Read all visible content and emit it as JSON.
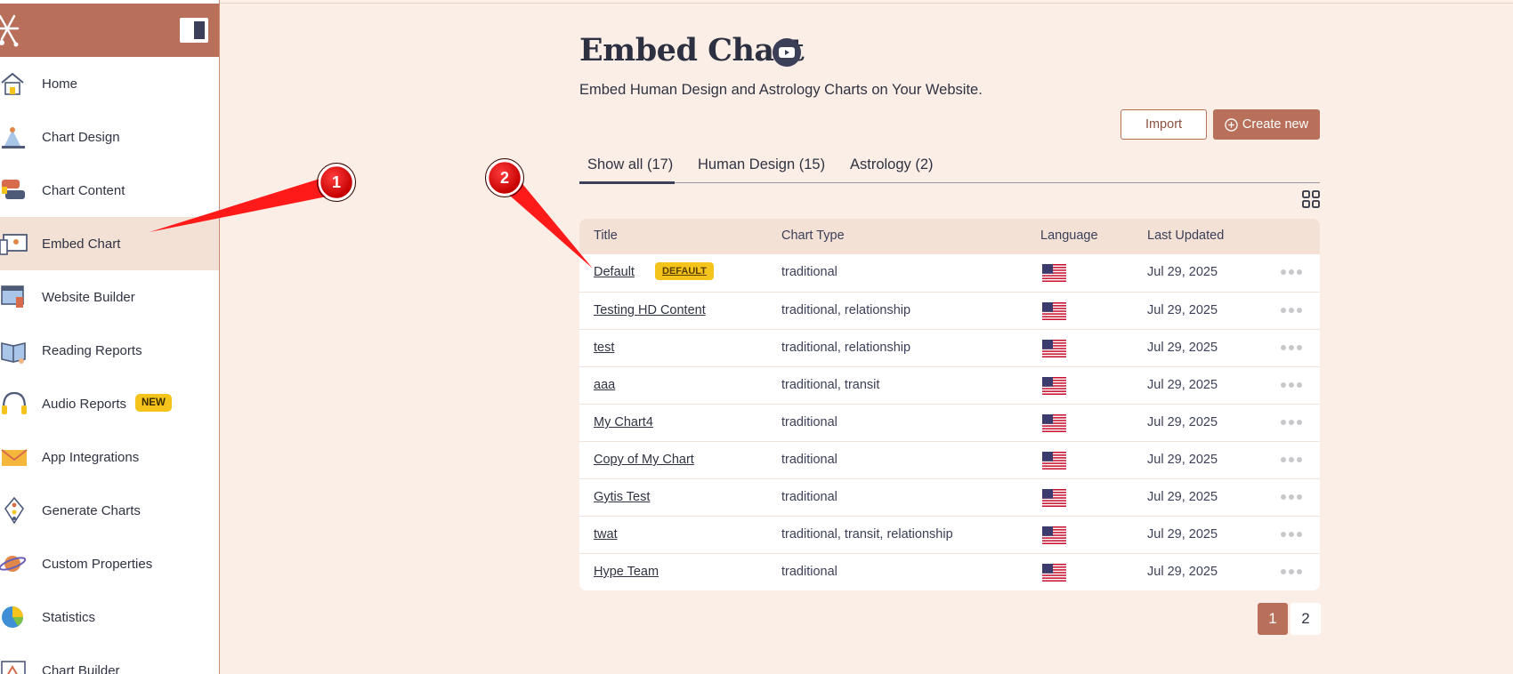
{
  "sidebar": {
    "items": [
      {
        "label": "Home",
        "icon": "home-icon"
      },
      {
        "label": "Chart Design",
        "icon": "chart-design-icon"
      },
      {
        "label": "Chart Content",
        "icon": "chart-content-icon"
      },
      {
        "label": "Embed Chart",
        "icon": "embed-chart-icon",
        "active": true
      },
      {
        "label": "Website Builder",
        "icon": "website-builder-icon"
      },
      {
        "label": "Reading Reports",
        "icon": "reading-reports-icon"
      },
      {
        "label": "Audio Reports",
        "icon": "headphones-icon",
        "badge": "NEW"
      },
      {
        "label": "App Integrations",
        "icon": "envelope-icon"
      },
      {
        "label": "Generate Charts",
        "icon": "generate-charts-icon"
      },
      {
        "label": "Custom Properties",
        "icon": "planet-icon"
      },
      {
        "label": "Statistics",
        "icon": "pie-chart-icon"
      },
      {
        "label": "Chart Builder",
        "icon": "chart-builder-icon"
      }
    ]
  },
  "header": {
    "title": "Embed Chart",
    "subtitle": "Embed Human Design and Astrology Charts on Your Website."
  },
  "actions": {
    "import_label": "Import",
    "create_label": "Create new"
  },
  "tabs": [
    {
      "label": "Show all (17)",
      "active": true
    },
    {
      "label": "Human Design (15)"
    },
    {
      "label": "Astrology (2)"
    }
  ],
  "table": {
    "columns": [
      "Title",
      "Chart Type",
      "Language",
      "Last Updated"
    ],
    "default_badge": "DEFAULT",
    "rows": [
      {
        "title": "Default",
        "type": "traditional",
        "date": "Jul 29, 2025",
        "is_default": true
      },
      {
        "title": "Testing HD Content",
        "type": "traditional, relationship",
        "date": "Jul 29, 2025"
      },
      {
        "title": "test",
        "type": "traditional, relationship",
        "date": "Jul 29, 2025"
      },
      {
        "title": "aaa",
        "type": "traditional, transit",
        "date": "Jul 29, 2025"
      },
      {
        "title": "My Chart4",
        "type": "traditional",
        "date": "Jul 29, 2025"
      },
      {
        "title": "Copy of My Chart",
        "type": "traditional",
        "date": "Jul 29, 2025"
      },
      {
        "title": "Gytis Test",
        "type": "traditional",
        "date": "Jul 29, 2025"
      },
      {
        "title": "twat",
        "type": "traditional, transit, relationship",
        "date": "Jul 29, 2025"
      },
      {
        "title": "Hype Team",
        "type": "traditional",
        "date": "Jul 29, 2025"
      }
    ]
  },
  "pagination": {
    "pages": [
      "1",
      "2"
    ],
    "current": "1"
  },
  "annotations": [
    {
      "label": "1"
    },
    {
      "label": "2"
    }
  ],
  "colors": {
    "brand": "#b8705a",
    "background": "#fbeee6",
    "badge": "#f5c41c"
  }
}
